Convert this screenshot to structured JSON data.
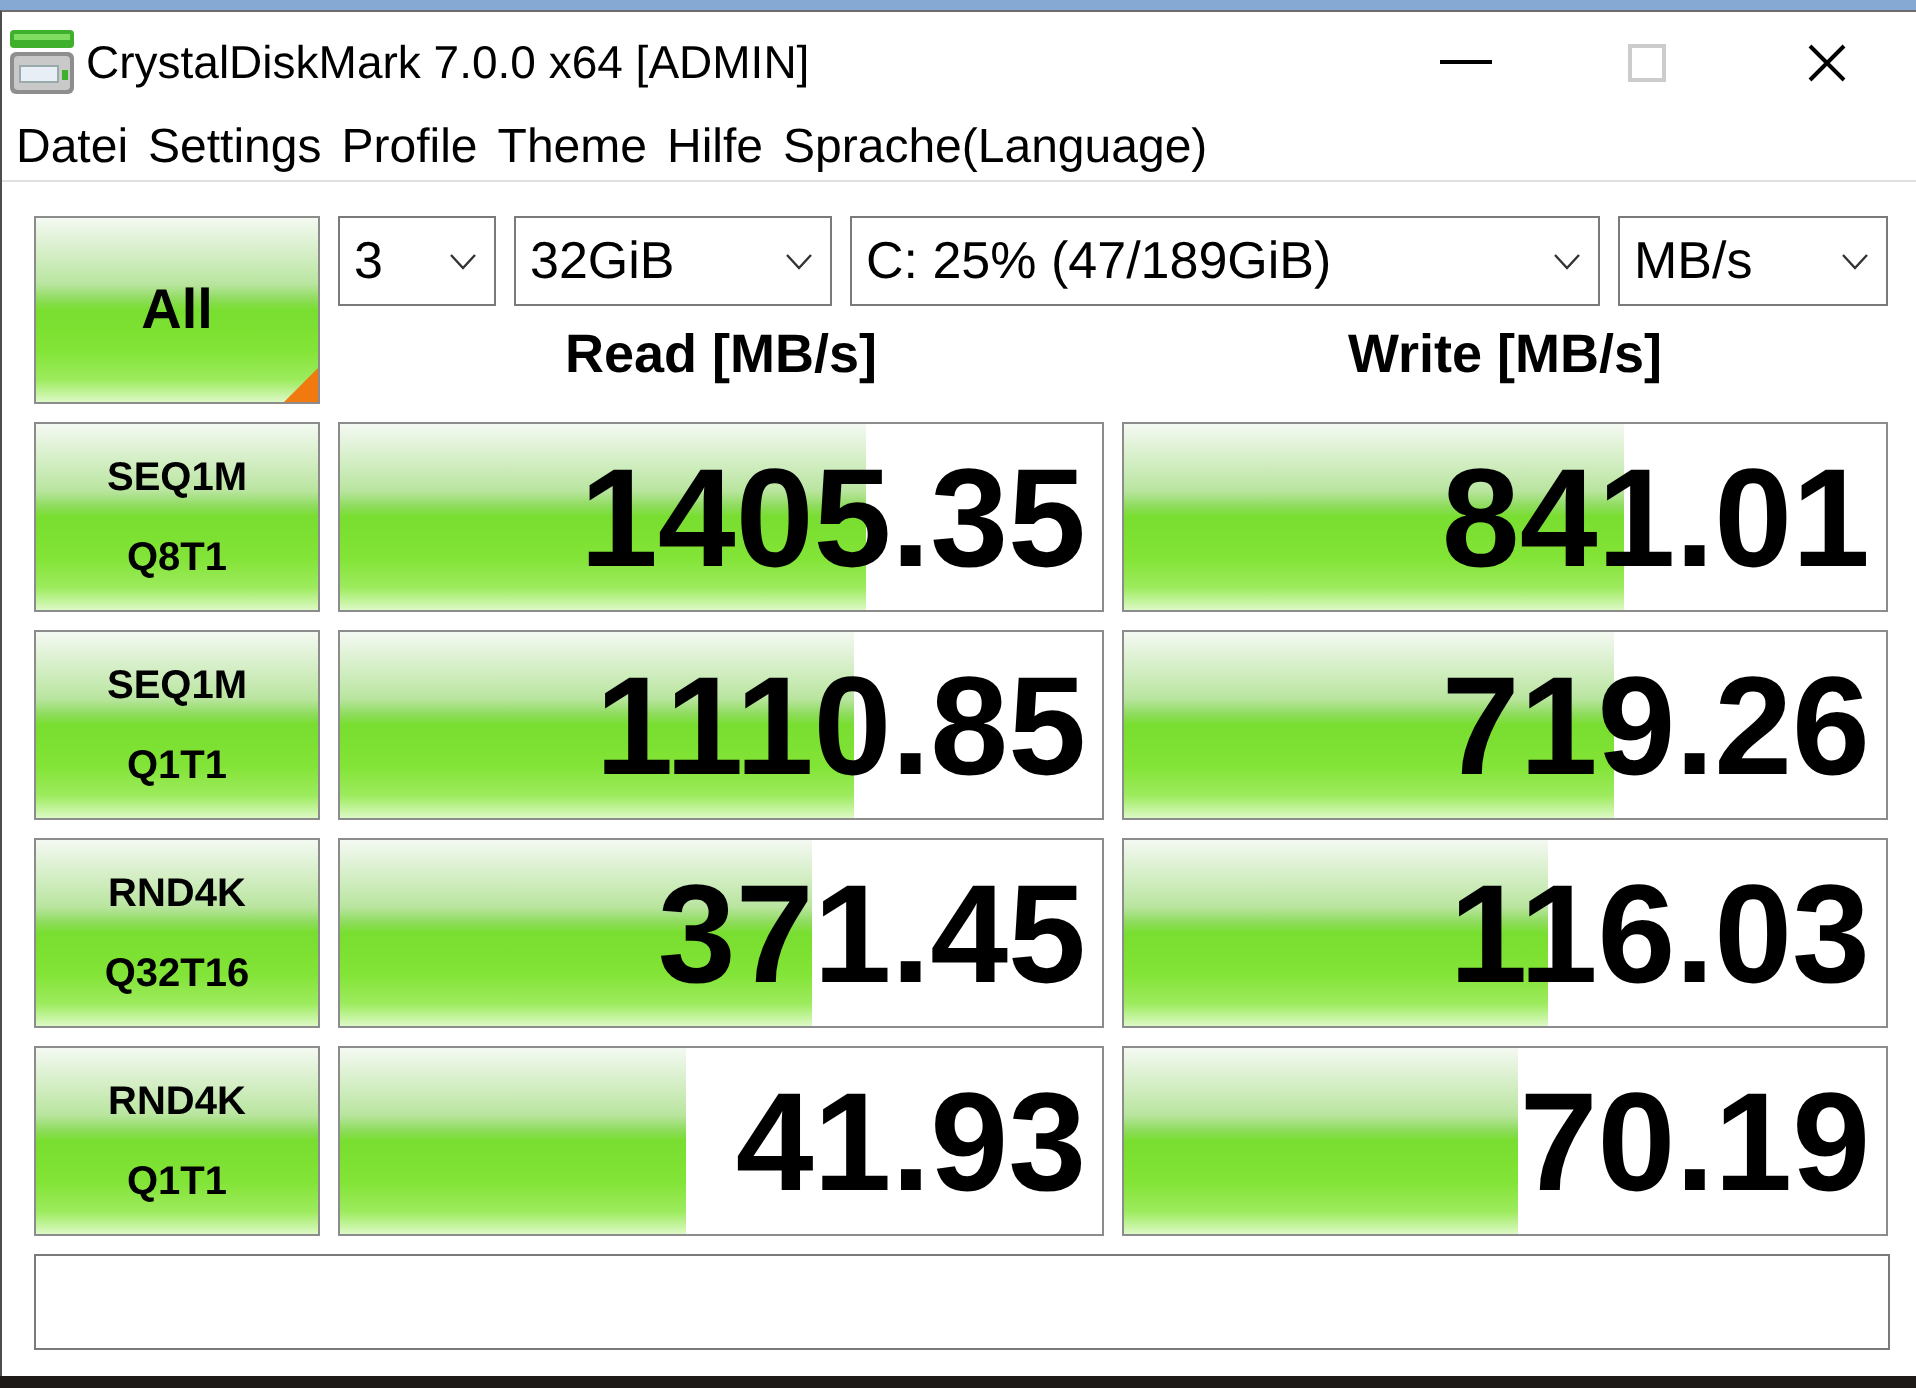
{
  "window": {
    "title": "CrystalDiskMark 7.0.0 x64 [ADMIN]",
    "maximize": {
      "disabled": true
    }
  },
  "menu": [
    "Datei",
    "Settings",
    "Profile",
    "Theme",
    "Hilfe",
    "Sprache(Language)"
  ],
  "all_button": {
    "label": "All"
  },
  "dropdowns": [
    {
      "value": "3"
    },
    {
      "value": "32GiB"
    },
    {
      "value": "C: 25% (47/189GiB)"
    },
    {
      "value": "MB/s"
    }
  ],
  "columns": [
    "Read [MB/s]",
    "Write [MB/s]"
  ],
  "tests": [
    {
      "name": "SEQ1M",
      "params": "Q8T1",
      "read": {
        "value": "1405.35",
        "level": 0.69
      },
      "write": {
        "value": "841.01",
        "level": 0.655
      }
    },
    {
      "name": "SEQ1M",
      "params": "Q1T1",
      "read": {
        "value": "1110.85",
        "level": 0.674
      },
      "write": {
        "value": "719.26",
        "level": 0.642
      }
    },
    {
      "name": "RND4K",
      "params": "Q32T16",
      "read": {
        "value": "371.45",
        "level": 0.62
      },
      "write": {
        "value": "116.03",
        "level": 0.556
      }
    },
    {
      "name": "RND4K",
      "params": "Q1T1",
      "read": {
        "value": "41.93",
        "level": 0.454
      },
      "write": {
        "value": "70.19",
        "level": 0.517
      }
    }
  ]
}
